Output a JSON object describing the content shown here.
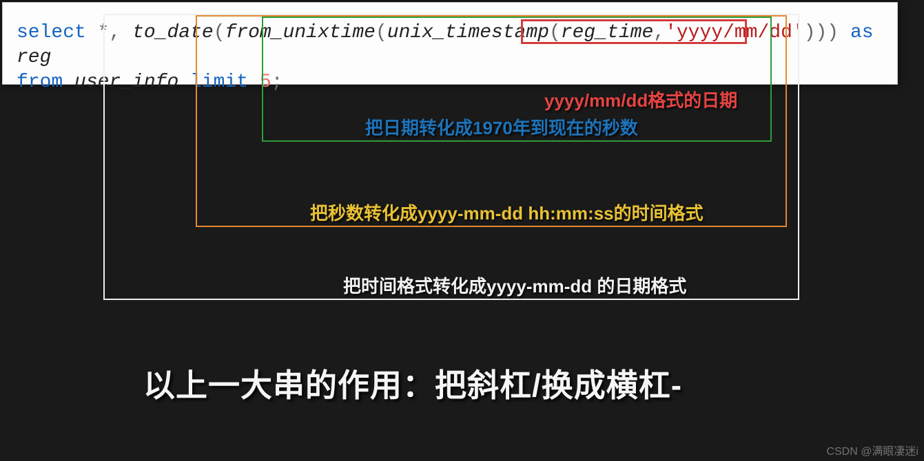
{
  "code": {
    "tokens": {
      "select": "select",
      "star": "*",
      "comma": ",",
      "to_date": "to_date",
      "lp": "(",
      "from_unixtime": "from_unixtime",
      "unix_timestamp": "unix_timestamp",
      "reg_time": "reg_time",
      "fmt_str": "'yyyy/mm/dd'",
      "rp3": ")))",
      "as": "as",
      "reg": "reg",
      "from": "from",
      "user_info": "user_info",
      "limit": "limit",
      "five": "5",
      "semi": ";"
    }
  },
  "annotations": {
    "red": "yyyy/mm/dd格式的日期",
    "blue": "把日期转化成1970年到现在的秒数",
    "yellow": "把秒数转化成yyyy-mm-dd hh:mm:ss的时间格式",
    "white": "把时间格式转化成yyyy-mm-dd 的日期格式"
  },
  "title": "以上一大串的作用：把斜杠/换成横杠-",
  "watermark": "CSDN @满眼凄迷i"
}
